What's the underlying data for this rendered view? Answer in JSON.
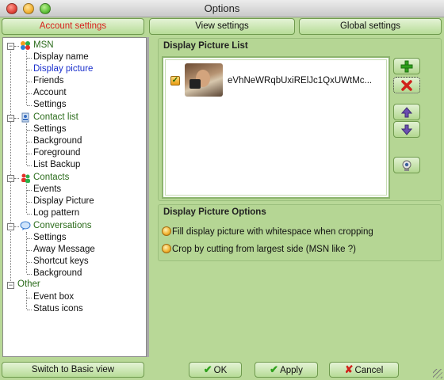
{
  "window": {
    "title": "Options"
  },
  "tabs": [
    {
      "label": "Account settings",
      "active": true
    },
    {
      "label": "View settings",
      "active": false
    },
    {
      "label": "Global settings",
      "active": false
    }
  ],
  "tree": {
    "groups": [
      {
        "label": "MSN",
        "icon": "msn-butterfly-icon",
        "items": [
          "Display name",
          "Display picture",
          "Friends",
          "Account",
          "Settings"
        ]
      },
      {
        "label": "Contact list",
        "icon": "contact-list-icon",
        "items": [
          "Settings",
          "Background",
          "Foreground",
          "List Backup"
        ]
      },
      {
        "label": "Contacts",
        "icon": "contacts-icon",
        "items": [
          "Events",
          "Display Picture",
          "Log pattern"
        ]
      },
      {
        "label": "Conversations",
        "icon": "speech-bubble-icon",
        "items": [
          "Settings",
          "Away Message",
          "Shortcut keys",
          "Background"
        ]
      },
      {
        "label": "Other",
        "icon": "",
        "items": [
          "Event box",
          "Status icons"
        ]
      }
    ],
    "selected": "Display picture"
  },
  "picture_list": {
    "title": "Display Picture List",
    "entries": [
      {
        "name": "eVhNeWRqbUxiRElJc1QxUWtMc...",
        "checked": true
      }
    ],
    "buttons": [
      "add-icon",
      "remove-icon",
      "move-up-icon",
      "move-down-icon",
      "webcam-icon"
    ]
  },
  "picture_options": {
    "title": "Display Picture Options",
    "options": [
      "Fill display picture with whitespace when cropping",
      "Crop by cutting from largest side (MSN like ?)"
    ]
  },
  "footer": {
    "basic_view": "Switch to Basic view",
    "ok": "OK",
    "apply": "Apply",
    "cancel": "Cancel"
  },
  "colors": {
    "active_tab_text": "#d8201b",
    "selected_tree_item": "#1a2fcc",
    "tree_group_text": "#2a6b1a",
    "background": "#b8d897"
  }
}
